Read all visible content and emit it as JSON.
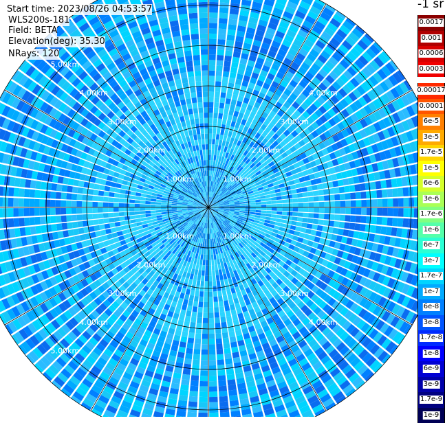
{
  "header": {
    "start_time": "Start time: 2023/08/26 04:53:57",
    "instrument": "WLS200s-181",
    "field": "Field: BETA",
    "elevation": "Elevation(deg): 35.30",
    "nrays": "NRays: 120"
  },
  "chart_data": {
    "type": "heatmap",
    "projection": "polar",
    "rings_km": [
      1,
      2,
      3,
      4,
      5
    ],
    "ring_labels": [
      "1.00km",
      "2.00km",
      "3.00km",
      "4.00km",
      "5.00km"
    ],
    "n_rays": 120,
    "max_range_km": 5.8,
    "colorbar": {
      "unit": "-1 sr",
      "upper_labels": [
        "0.0017",
        "0.001",
        "0.0006",
        "0.0003"
      ],
      "upper_colors": [
        "#8b0000",
        "#b00000",
        "#d80000",
        "#f00000"
      ],
      "lower_labels": [
        "0.00017",
        "0.0001",
        "6e-5",
        "3e-5",
        "1.7e-5",
        "1e-5",
        "6e-6",
        "3e-6",
        "1.7e-6",
        "1e-6",
        "6e-7",
        "3e-7",
        "1.7e-7",
        "1e-7",
        "6e-8",
        "3e-8",
        "1.7e-8",
        "1e-8",
        "6e-9",
        "3e-9",
        "1.7e-9",
        "1e-9"
      ],
      "lower_colors": [
        "#ff2a00",
        "#ff5500",
        "#ff8000",
        "#ffaa00",
        "#ffd400",
        "#ffff00",
        "#d4ff2b",
        "#aaff55",
        "#80ff80",
        "#55ffaa",
        "#2bffd4",
        "#00ffff",
        "#00d4ff",
        "#00aaff",
        "#0080ff",
        "#0055ff",
        "#002bff",
        "#0000ff",
        "#0000d4",
        "#0000aa",
        "#000080",
        "#000055"
      ]
    }
  }
}
